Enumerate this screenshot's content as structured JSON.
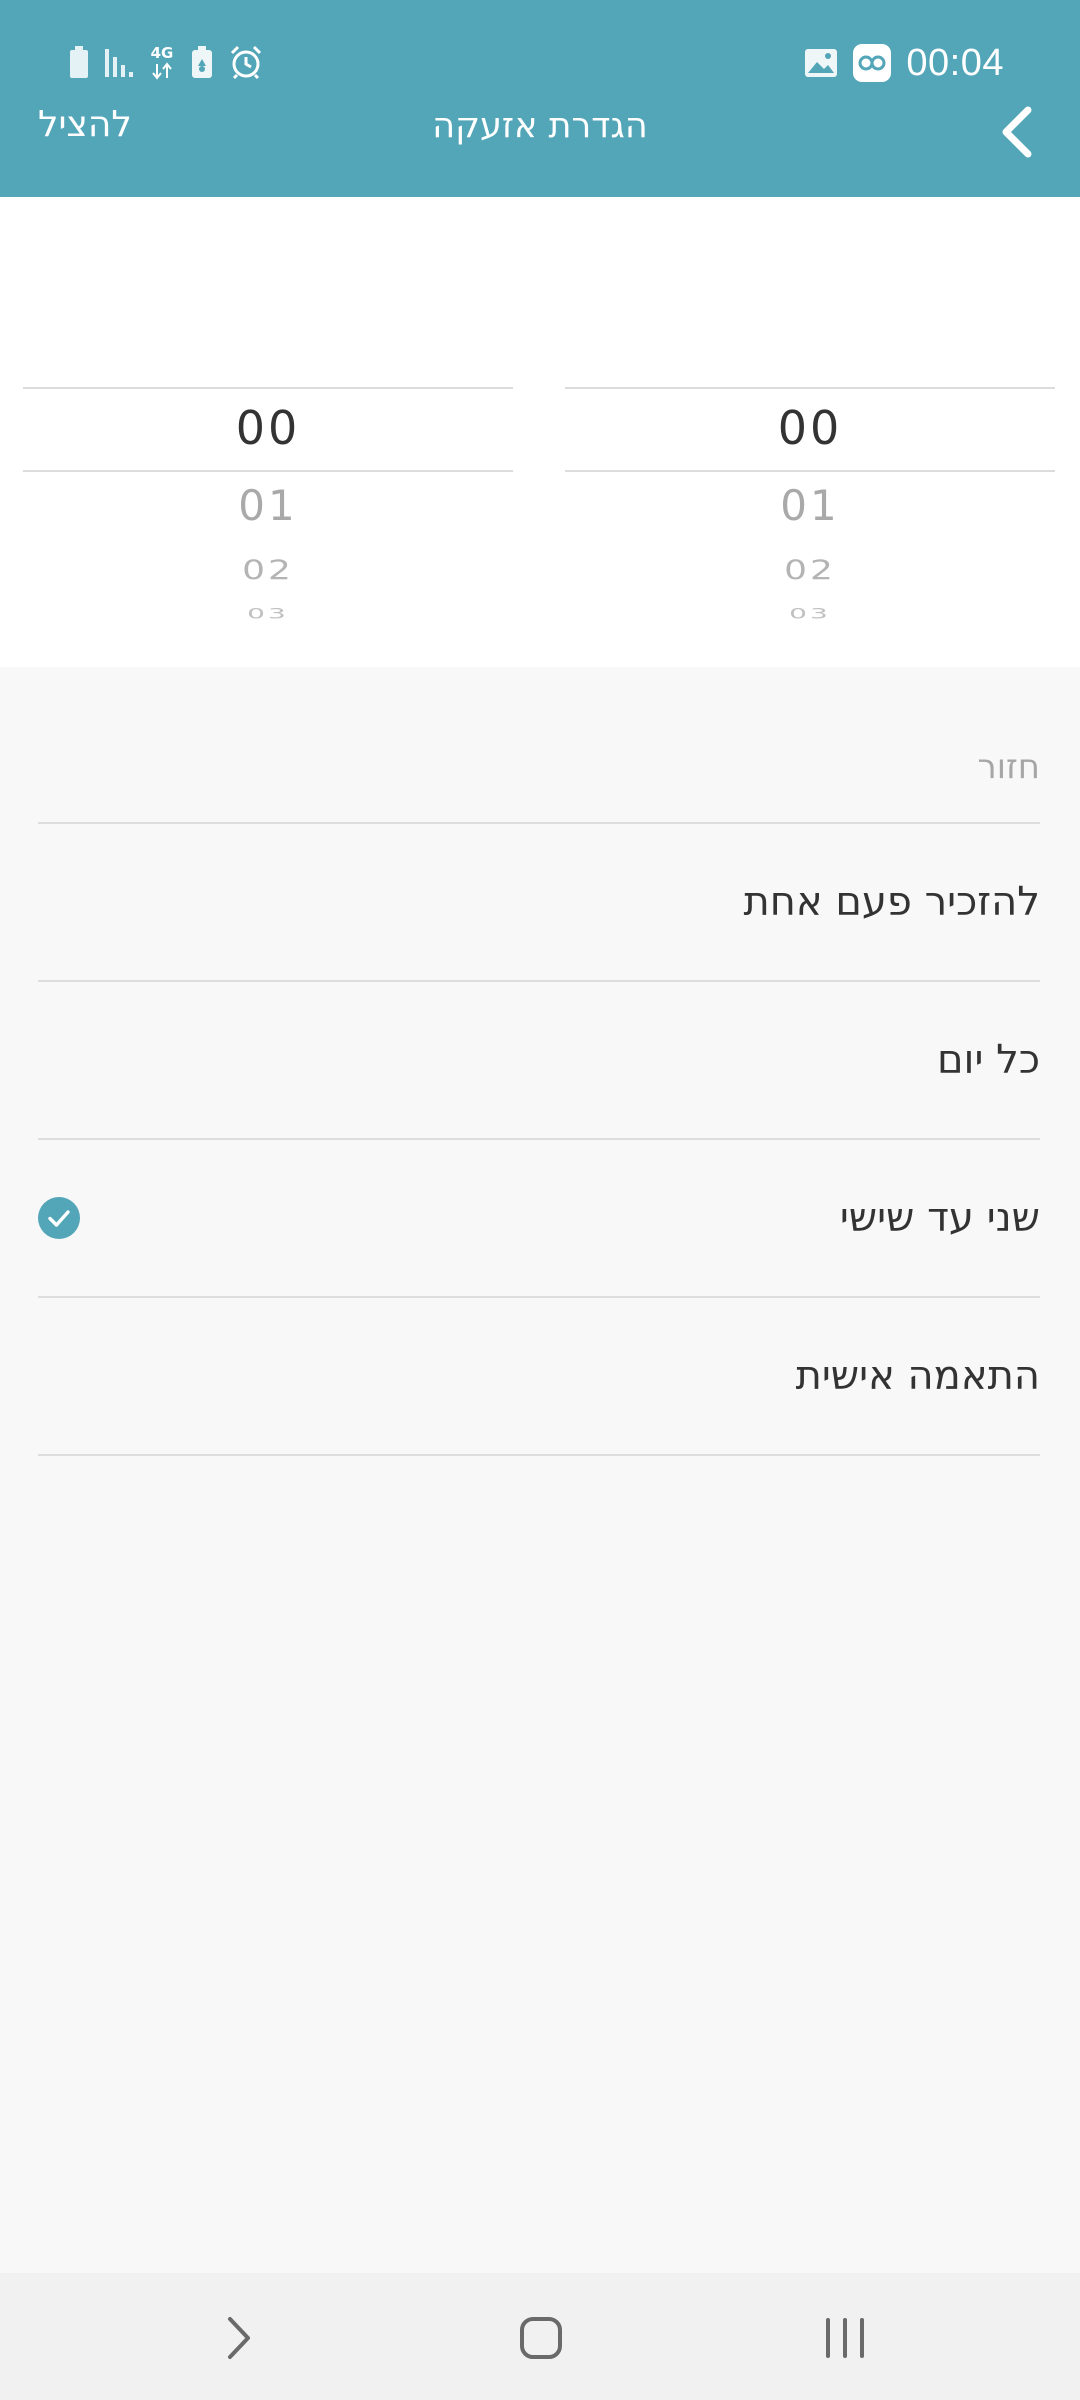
{
  "status_bar": {
    "time": "00:04",
    "network_label": "4G",
    "icons": [
      "battery-icon",
      "signal-icon",
      "network-4g-icon",
      "battery-saver-icon",
      "alarm-icon",
      "gallery-icon",
      "app-notification-icon"
    ]
  },
  "header": {
    "title": "הגדרת אזעקה",
    "save_label": "להציל",
    "back_icon": "chevron-left-icon",
    "background_color": "#53a5b8"
  },
  "pickers": {
    "left": {
      "selected": "00",
      "next": [
        "01",
        "02",
        "03"
      ]
    },
    "right": {
      "selected": "00",
      "next": [
        "01",
        "02",
        "03"
      ]
    }
  },
  "repeat": {
    "label": "חזור",
    "options": [
      {
        "label": "להזכיר פעם אחת",
        "selected": false
      },
      {
        "label": "כל יום",
        "selected": false
      },
      {
        "label": "שני עד שישי",
        "selected": true
      },
      {
        "label": "התאמה אישית",
        "selected": false
      }
    ],
    "check_color": "#53a5b8"
  },
  "nav_bar": {
    "buttons": [
      "back-nav-icon",
      "home-icon",
      "recent-apps-icon"
    ]
  }
}
